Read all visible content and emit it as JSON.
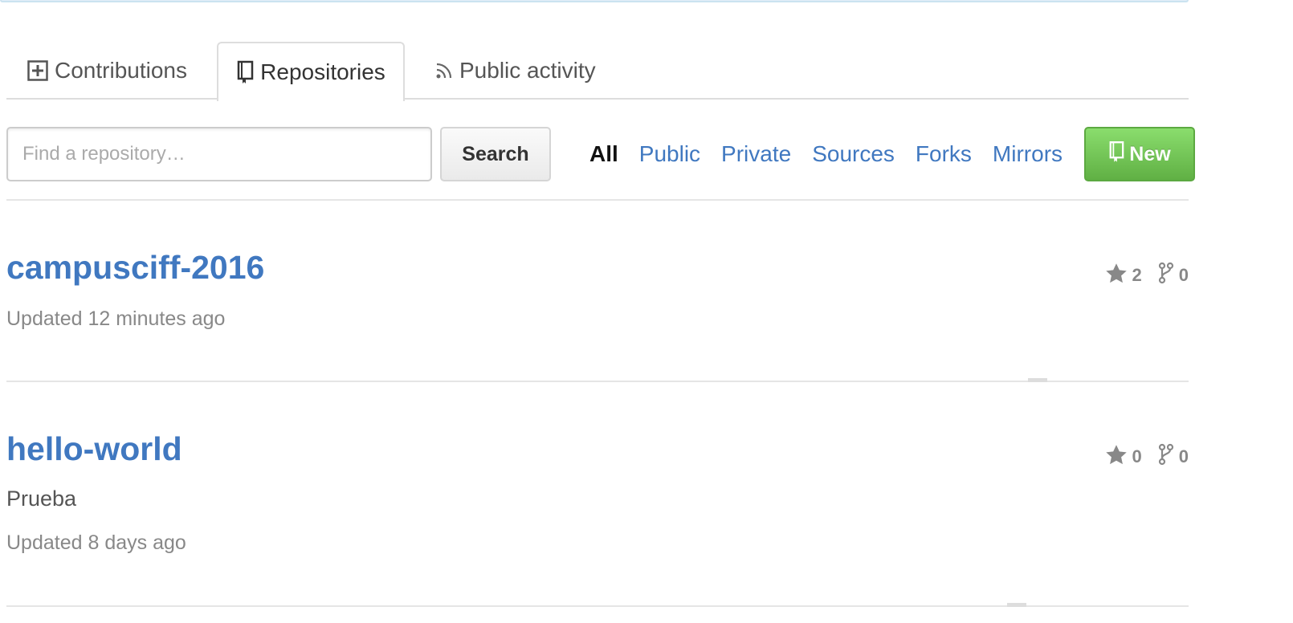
{
  "tabs": [
    {
      "label": "Contributions",
      "icon": "plus-square-icon"
    },
    {
      "label": "Repositories",
      "icon": "repo-book-icon",
      "selected": true
    },
    {
      "label": "Public activity",
      "icon": "rss-icon"
    }
  ],
  "search": {
    "placeholder": "Find a repository…",
    "value": "",
    "button_label": "Search"
  },
  "filters": [
    {
      "label": "All",
      "selected": true
    },
    {
      "label": "Public"
    },
    {
      "label": "Private"
    },
    {
      "label": "Sources"
    },
    {
      "label": "Forks"
    },
    {
      "label": "Mirrors"
    }
  ],
  "new_button": {
    "label": "New",
    "icon": "repo-book-icon"
  },
  "repos": [
    {
      "name": "campusciff-2016",
      "description": "",
      "updated": "Updated 12 minutes ago",
      "stars": "2",
      "forks": "0"
    },
    {
      "name": "hello-world",
      "description": "Prueba",
      "updated": "Updated 8 days ago",
      "stars": "0",
      "forks": "0"
    }
  ],
  "colors": {
    "link": "#4078c0",
    "new_button": "#60b044",
    "muted": "#888888"
  }
}
